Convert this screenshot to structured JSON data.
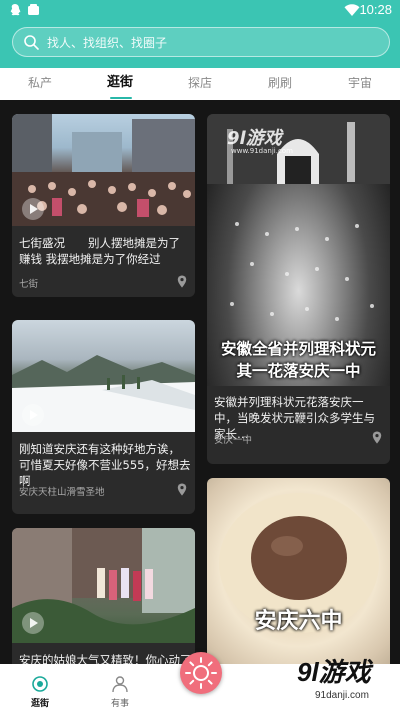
{
  "status_bar": {
    "time": "10:28"
  },
  "search": {
    "placeholder": "找人、找组织、找圈子"
  },
  "tabs": [
    {
      "label": "私产"
    },
    {
      "label": "逛街",
      "active": true
    },
    {
      "label": "探店"
    },
    {
      "label": "刷刷"
    },
    {
      "label": "宇宙"
    }
  ],
  "cards": [
    {
      "title": "七街盛况　　别人摆地摊是为了赚钱 我摆地摊是为了你经过",
      "tag": "七街"
    },
    {
      "overlay": "安徽全省并列理科状元 其一花落安庆一中",
      "title": "安徽并列理科状元花落安庆一中，当晚发状元鞭引众多学生与家长…",
      "tag": "安庆一中"
    },
    {
      "title": "刚知道安庆还有这种好地方诶，可惜夏天好像不营业555，好想去啊",
      "tag": "安庆天柱山滑雪圣地"
    },
    {
      "title": "安庆的姑娘大气又精致！你心动了"
    },
    {
      "overlay": "安庆六中"
    }
  ],
  "watermark": {
    "logo": "9l游戏",
    "url": "91danji.com",
    "inset_logo": "9l游戏",
    "inset_url": "www.91danji.com"
  },
  "bottom_nav": {
    "items": [
      {
        "label": "逛街",
        "active": true
      },
      {
        "label": "有事"
      }
    ]
  },
  "colors": {
    "header": "#3bc5b3",
    "accent": "#27b7a8",
    "fab": "#f06e7c",
    "feed_bg": "#151515",
    "card_bg": "#2b2b2b"
  }
}
